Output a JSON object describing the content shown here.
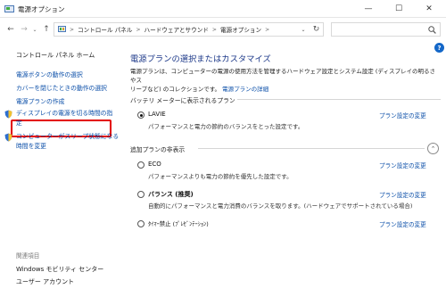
{
  "window": {
    "title": "電源オプション",
    "minimize_glyph": "—",
    "maximize_glyph": "☐",
    "close_glyph": "✕"
  },
  "nav": {
    "back_glyph": "←",
    "forward_glyph": "→",
    "recent_glyph": "⌄",
    "up_glyph": "↑",
    "breadcrumb": [
      "コントロール パネル",
      "ハードウェアとサウンド",
      "電源オプション"
    ],
    "breadcrumb_sep": ">",
    "lead_sep": ">",
    "dropdown_glyph": "⌄",
    "refresh_glyph": "↻",
    "search_placeholder": ""
  },
  "sidebar": {
    "home": "コントロール パネル ホーム",
    "tasks": [
      {
        "label": "電源ボタンの動作の選択",
        "shield": false
      },
      {
        "label": "カバーを閉じたときの動作の選択",
        "shield": false,
        "highlighted": true
      },
      {
        "label": "電源プランの作成",
        "shield": false
      },
      {
        "label": "ディスプレイの電源を切る時間の指",
        "label2": "定",
        "shield": true
      },
      {
        "label": "コンピューターがスリープ状態になる",
        "label2": "時間を変更",
        "shield": true
      }
    ],
    "see_also_title": "関連項目",
    "see_also": [
      "Windows モビリティ センター",
      "ユーザー アカウント"
    ]
  },
  "main": {
    "help_glyph": "?",
    "heading": "電源プランの選択またはカスタマイズ",
    "description_line1": "電源プランは、コンピューターの電源の使用方法を管理するハードウェア設定とシステム設定 (ディスプレイの明るさやス",
    "description_line2": "リープなど) のコレクションです。",
    "description_link": "電源プランの詳細",
    "group_battery": "バッテリ メーターに表示されるプラン",
    "group_hidden": "追加プランの非表示",
    "collapse_glyph": "⌃",
    "plans": [
      {
        "name": "LAVIE",
        "desc": "パフォーマンスと電力の節約のバランスをとった設定です。",
        "link": "プラン設定の変更",
        "selected": true
      },
      {
        "name": "ECO",
        "desc": "パフォーマンスよりも電力の節約を優先した設定です。",
        "link": "プラン設定の変更",
        "selected": false
      },
      {
        "name": "バランス (推奨)",
        "desc": "自動的にパフォーマンスと電力消費のバランスを取ります。(ハードウェアでサポートされている場合)",
        "link": "プラン設定の変更",
        "selected": false
      },
      {
        "name": "ﾀｲﾏｰ禁止 (ﾌﾟﾚｾﾞﾝﾃｰｼｮﾝ)",
        "desc": "",
        "link": "プラン設定の変更",
        "selected": false
      }
    ]
  },
  "colors": {
    "link": "#0a4ea8",
    "heading": "#1e3a8a",
    "highlight": "#e30000"
  }
}
